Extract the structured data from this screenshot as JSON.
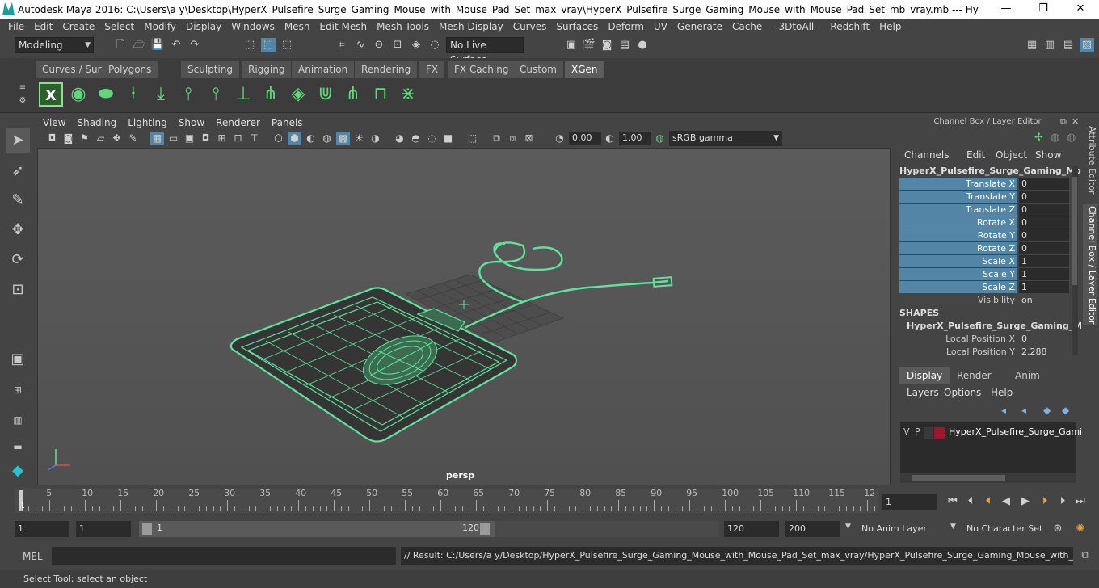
{
  "titlebar": {
    "title": "Autodesk Maya 2016: C:\\Users\\a y\\Desktop\\HyperX_Pulsefire_Surge_Gaming_Mouse_with_Mouse_Pad_Set_max_vray\\HyperX_Pulsefire_Surge_Gaming_Mouse_with_Mouse_Pad_Set_mb_vray.mb  ---  HyperX_Pulsefire_Surge_G...",
    "minimize": "—",
    "maximize": "❐",
    "close": "✕"
  },
  "menubar": [
    "File",
    "Edit",
    "Create",
    "Select",
    "Modify",
    "Display",
    "Windows",
    "Mesh",
    "Edit Mesh",
    "Mesh Tools",
    "Mesh Display",
    "Curves",
    "Surfaces",
    "Deform",
    "UV",
    "Generate",
    "Cache",
    "- 3DtoAll -",
    "Redshift",
    "Help"
  ],
  "statusline": {
    "mode": "Modeling",
    "live_surface": "No Live Surface"
  },
  "shelf_tabs": [
    "Curves / Surfaces",
    "Polygons",
    "Sculpting",
    "Rigging",
    "Animation",
    "Rendering",
    "FX",
    "FX Caching",
    "Custom",
    "XGen"
  ],
  "shelf_active_tab": "XGen",
  "viewport_menu": [
    "View",
    "Shading",
    "Lighting",
    "Show",
    "Renderer",
    "Panels"
  ],
  "viewport_toolbar": {
    "exposure": "0.00",
    "gamma": "1.00",
    "color_space": "sRGB gamma"
  },
  "viewport": {
    "camera_label": "persp"
  },
  "channel_box": {
    "header": "Channel Box / Layer Editor",
    "menu": [
      "Channels",
      "Edit",
      "Object",
      "Show"
    ],
    "object_name": "HyperX_Pulsefire_Surge_Gaming_Mo...",
    "channels": [
      {
        "label": "Translate X",
        "value": "0"
      },
      {
        "label": "Translate Y",
        "value": "0"
      },
      {
        "label": "Translate Z",
        "value": "0"
      },
      {
        "label": "Rotate X",
        "value": "0"
      },
      {
        "label": "Rotate Y",
        "value": "0"
      },
      {
        "label": "Rotate Z",
        "value": "0"
      },
      {
        "label": "Scale X",
        "value": "1"
      },
      {
        "label": "Scale Y",
        "value": "1"
      },
      {
        "label": "Scale Z",
        "value": "1"
      },
      {
        "label": "Visibility",
        "value": "on"
      }
    ],
    "shapes_header": "SHAPES",
    "shape_name": "HyperX_Pulsefire_Surge_Gaming_M...",
    "shape_channels": [
      {
        "label": "Local Position X",
        "value": "0"
      },
      {
        "label": "Local Position Y",
        "value": "2.288"
      }
    ]
  },
  "layer_editor": {
    "tabs": [
      "Display",
      "Render",
      "Anim"
    ],
    "active_tab": "Display",
    "menu": [
      "Layers",
      "Options",
      "Help"
    ],
    "layer": {
      "v": "V",
      "p": "P",
      "name": "HyperX_Pulsefire_Surge_Gamin",
      "color": "#a0152e"
    }
  },
  "side_tabs": [
    "Attribute Editor",
    "Channel Box / Layer Editor"
  ],
  "timeline": {
    "labels": [
      "5",
      "10",
      "15",
      "20",
      "25",
      "30",
      "35",
      "40",
      "45",
      "50",
      "55",
      "60",
      "65",
      "70",
      "75",
      "80",
      "85",
      "90",
      "95",
      "100",
      "105",
      "110",
      "115",
      "12"
    ],
    "current_frame": "1",
    "start_marker": "1"
  },
  "range": {
    "start": "1",
    "playback_start": "1",
    "slider_start": "1",
    "slider_end": "120",
    "playback_end": "120",
    "end": "200",
    "anim_layer": "No Anim Layer",
    "character_set": "No Character Set"
  },
  "mel": {
    "label": "MEL",
    "result": "// Result: C:/Users/a y/Desktop/HyperX_Pulsefire_Surge_Gaming_Mouse_with_Mouse_Pad_Set_max_vray/HyperX_Pulsefire_Surge_Gaming_Mouse_with_Mouse_Pa"
  },
  "help_line": "Select Tool: select an object",
  "colors": {
    "wireframe": "#5ee39a",
    "channel_highlight": "#5285a6",
    "accent": "#5fd77a"
  }
}
